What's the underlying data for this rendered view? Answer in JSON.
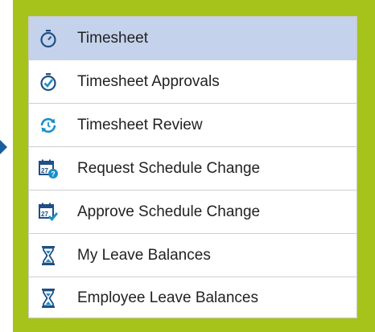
{
  "menu": {
    "items": [
      {
        "label": "Timesheet",
        "icon": "stopwatch-icon",
        "selected": true
      },
      {
        "label": "Timesheet Approvals",
        "icon": "stopwatch-check-icon",
        "selected": false
      },
      {
        "label": "Timesheet Review",
        "icon": "refresh-clock-icon",
        "selected": false
      },
      {
        "label": "Request Schedule Change",
        "icon": "calendar-question-icon",
        "selected": false
      },
      {
        "label": "Approve Schedule Change",
        "icon": "calendar-check-icon",
        "selected": false
      },
      {
        "label": "My Leave Balances",
        "icon": "hourglass-icon",
        "selected": false
      },
      {
        "label": "Employee Leave Balances",
        "icon": "hourglass-icon",
        "selected": false
      }
    ]
  },
  "colors": {
    "frame": "#a6c31c",
    "selected_row": "#c4d2eb",
    "icon_dark": "#1f4f84",
    "icon_teal": "#1a8fc9",
    "pointer": "#1b5e9e"
  }
}
